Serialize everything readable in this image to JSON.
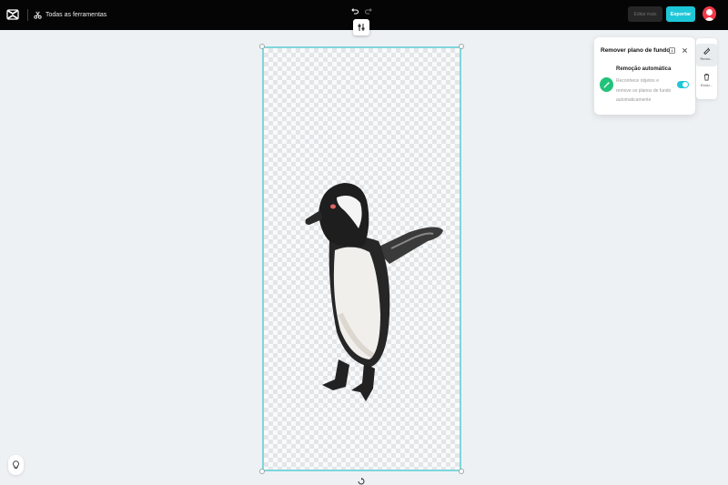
{
  "topbar": {
    "all_tools_label": "Todas as ferramentas",
    "edit_more_label": "Editar mais",
    "export_label": "Exportar"
  },
  "panel": {
    "title": "Remover plano de fundo",
    "auto_removal_title": "Remoção automática",
    "auto_removal_desc": "Reconhece objetos e remove os planos de fundo automaticamente",
    "auto_removal_enabled": true
  },
  "rail": {
    "remove_label": "Remo...",
    "delete_label": "Exclu..."
  },
  "colors": {
    "accent": "#1ec7d8",
    "topbar": "#050505",
    "canvas_border": "#7fd6dc",
    "avatar": "#f4384a",
    "auto_icon": "#23c27b"
  }
}
